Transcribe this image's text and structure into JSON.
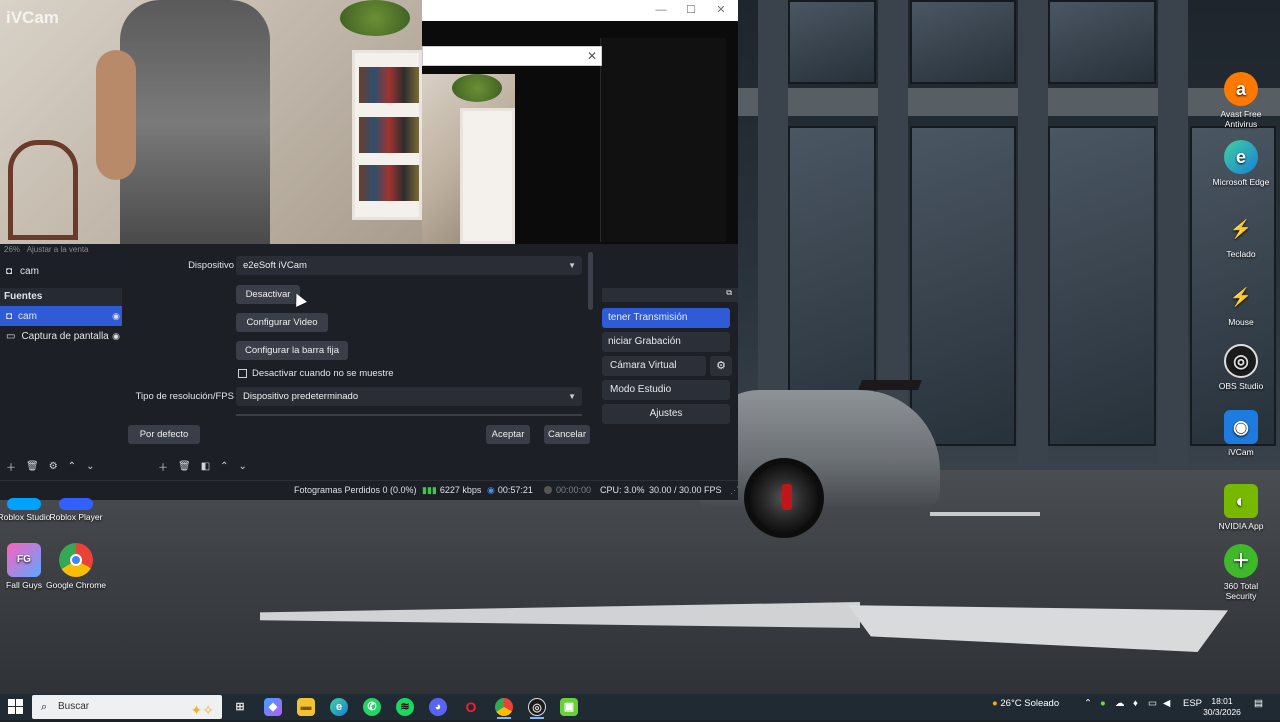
{
  "camera": {
    "watermark": "iVCam"
  },
  "obs": {
    "zoom_text": "26%",
    "zoom_fit": "Ajustar a la venta",
    "scene_name": "cam",
    "sources_header": "Fuentes",
    "sources": [
      {
        "label": "cam",
        "selected": true
      },
      {
        "label": "Captura de pantalla",
        "selected": false
      }
    ],
    "controls": {
      "stop_stream": "tener Transmisión",
      "start_recording": "niciar Grabación",
      "virtual_camera": "Cámara Virtual",
      "studio_mode": "Modo Estudio",
      "settings": "Ajustes"
    },
    "status": {
      "dropped_frames": "Fotogramas Perdidos 0 (0.0%)",
      "bitrate": "6227 kbps",
      "stream_time": "00:57:21",
      "rec_time": "00:00:00",
      "cpu": "CPU: 3.0%",
      "fps": "30.00 / 30.00 FPS"
    }
  },
  "dialog": {
    "device_label": "Dispositivo",
    "device_value": "e2eSoft iVCam",
    "deactivate_button": "Desactivar",
    "config_video_button": "Configurar Video",
    "config_bar_button": "Configurar la barra fija",
    "deactivate_hidden_label": "Desactivar cuando no se muestre",
    "deactivate_hidden_checked": false,
    "resolution_label": "Tipo de resolución/FPS",
    "resolution_value": "Dispositivo predeterminado",
    "defaults_button": "Por defecto",
    "accept_button": "Aceptar",
    "cancel_button": "Cancelar"
  },
  "desktop_icons": {
    "avast": "Avast Free Antivirus",
    "edge": "Microsoft Edge",
    "teclado": "Teclado",
    "mouse": "Mouse",
    "obs": "OBS Studio",
    "ivcam": "iVCam",
    "nvidia": "NVIDIA App",
    "total360": "360 Total Security",
    "roblox_studio": "Roblox Studio",
    "roblox_player": "Roblox Player",
    "fall_guys": "Fall Guys",
    "chrome": "Google Chrome"
  },
  "taskbar": {
    "search_placeholder": "Buscar",
    "weather": "26°C Soleado",
    "language": "ESP",
    "time": "18:01",
    "date": "30/3/2026"
  },
  "colors": {
    "accent": "#2f5bd6",
    "obs_bg": "#1d1f26",
    "taskbar_bg": "#1f2a33"
  }
}
